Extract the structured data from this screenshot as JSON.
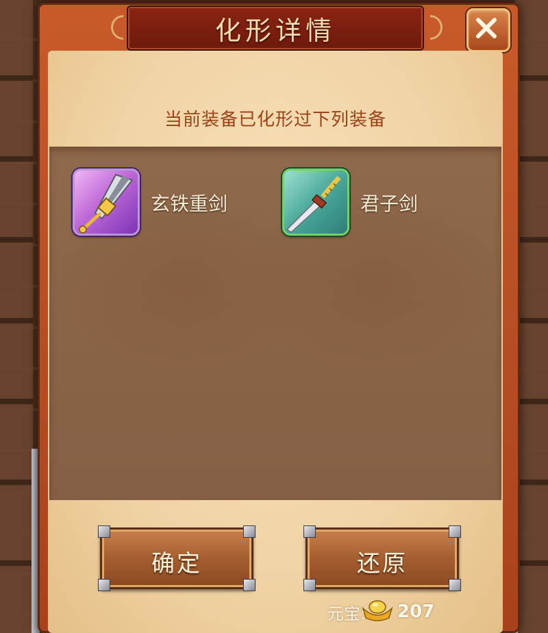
{
  "dialog": {
    "title": "化形详情",
    "subtitle": "当前装备已化形过下列装备",
    "close_icon": "close-x-icon"
  },
  "items": [
    {
      "name": "玄铁重剑",
      "rarity_color": "#c06ad8",
      "icon": "heavy-iron-sword-icon"
    },
    {
      "name": "君子剑",
      "rarity_color": "#4aa89a",
      "icon": "gentleman-sword-icon"
    }
  ],
  "buttons": {
    "confirm_label": "确定",
    "restore_label": "还原"
  },
  "currency": {
    "label": "元宝:",
    "icon": "gold-ingot-icon",
    "value": "207"
  },
  "colors": {
    "frame": "#c85a2a",
    "title_bar": "#8a2412",
    "parchment": "#f0d3a4",
    "subtitle_text": "#9c4418",
    "list_area": "#8a6448",
    "button": "#a55e30"
  }
}
